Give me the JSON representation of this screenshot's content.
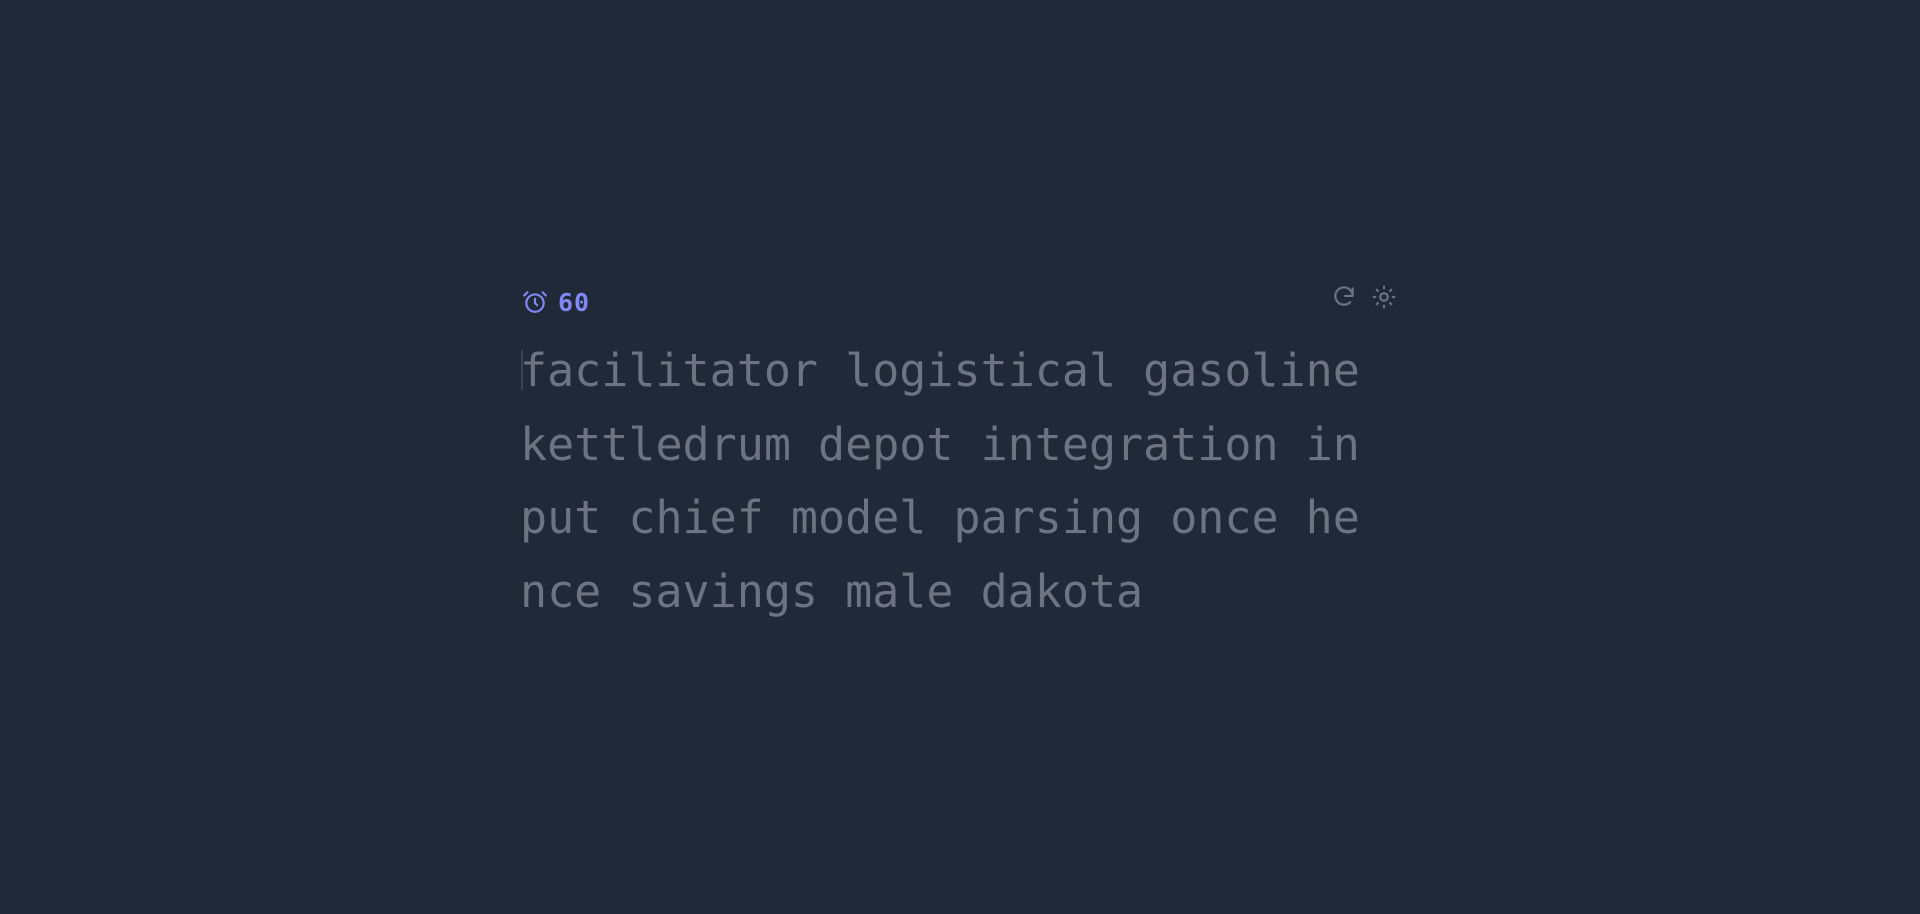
{
  "timer": {
    "icon": "alarm-clock-icon",
    "value": "60",
    "color": "#8187f5"
  },
  "controls": {
    "restart_icon": "restart-icon",
    "theme_icon": "sun-icon"
  },
  "typing": {
    "lines": [
      "facilitator logistical gasoline",
      "kettledrum depot integration in",
      "put chief model parsing once he",
      "nce savings male dakota"
    ]
  },
  "colors": {
    "background": "#202938",
    "text_untyped": "#6d7380",
    "accent": "#8187f5"
  }
}
